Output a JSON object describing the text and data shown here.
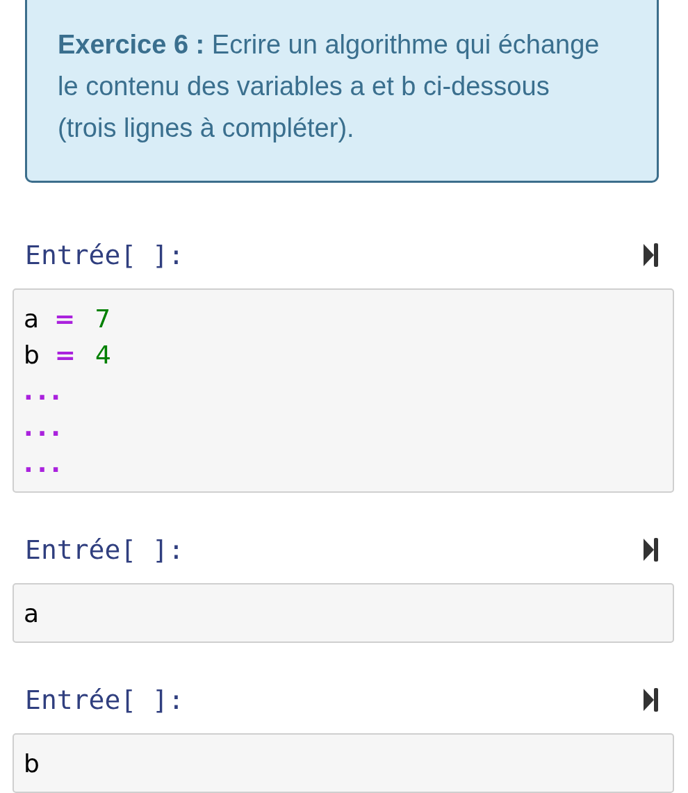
{
  "exercise": {
    "text": "**Exercice 6 :** Ecrire un algorithme qui échange le contenu des variables a et b ci-dessous (trois lignes à compléter)."
  },
  "cells": [
    {
      "prompt": "Entrée[ ]:",
      "lines": [
        [
          {
            "kind": "name",
            "text": "a"
          },
          {
            "kind": "operator",
            "text": "="
          },
          {
            "kind": "number",
            "text": "7"
          }
        ],
        [
          {
            "kind": "name",
            "text": "b"
          },
          {
            "kind": "operator",
            "text": "="
          },
          {
            "kind": "number",
            "text": "4"
          }
        ],
        [
          {
            "kind": "operator",
            "text": "..."
          }
        ],
        [
          {
            "kind": "operator",
            "text": "..."
          }
        ],
        [
          {
            "kind": "operator",
            "text": "..."
          }
        ]
      ]
    },
    {
      "prompt": "Entrée[ ]:",
      "lines": [
        [
          {
            "kind": "name",
            "text": "a"
          }
        ]
      ]
    },
    {
      "prompt": "Entrée[ ]:",
      "lines": [
        [
          {
            "kind": "name",
            "text": "b"
          }
        ]
      ]
    }
  ]
}
